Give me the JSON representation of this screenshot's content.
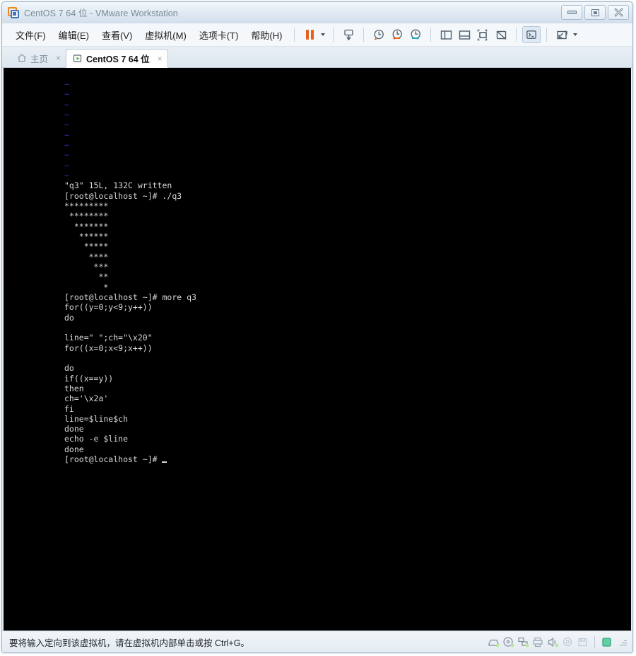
{
  "window": {
    "title": "CentOS 7 64 位 - VMware Workstation",
    "logo_icon": "vmware-logo-icon",
    "controls": {
      "minimize": "minimize-button",
      "maximize": "maximize-button",
      "close": "close-button"
    }
  },
  "menubar": {
    "items": [
      {
        "label": "文件(F)",
        "name": "menu-file"
      },
      {
        "label": "编辑(E)",
        "name": "menu-edit"
      },
      {
        "label": "查看(V)",
        "name": "menu-view"
      },
      {
        "label": "虚拟机(M)",
        "name": "menu-vm"
      },
      {
        "label": "选项卡(T)",
        "name": "menu-tabs"
      },
      {
        "label": "帮助(H)",
        "name": "menu-help"
      }
    ],
    "toolbar": [
      {
        "name": "pause-button",
        "icon": "pause-icon"
      },
      {
        "name": "pause-dropdown",
        "icon": "chevron-down-icon"
      },
      {
        "name": "send-ctrl-alt-del-button",
        "icon": "keyboard-send-icon"
      },
      {
        "name": "snapshot-take-button",
        "icon": "snapshot-clock-icon"
      },
      {
        "name": "snapshot-revert-button",
        "icon": "snapshot-revert-icon"
      },
      {
        "name": "snapshot-manager-button",
        "icon": "snapshot-manager-icon"
      },
      {
        "name": "show-library-button",
        "icon": "panel-left-icon"
      },
      {
        "name": "show-thumbnail-bar-button",
        "icon": "panel-bottom-icon"
      },
      {
        "name": "full-screen-button",
        "icon": "fullscreen-icon"
      },
      {
        "name": "unity-mode-button",
        "icon": "unity-mode-icon"
      },
      {
        "name": "console-view-button",
        "icon": "console-icon",
        "active": true
      },
      {
        "name": "stretch-guest-button",
        "icon": "stretch-icon"
      },
      {
        "name": "stretch-dropdown",
        "icon": "chevron-down-icon"
      }
    ]
  },
  "tabs": [
    {
      "label": "主页",
      "icon": "home-icon",
      "active": false,
      "close": "×",
      "name": "tab-home"
    },
    {
      "label": "CentOS 7 64 位",
      "icon": "vm-play-icon",
      "active": true,
      "close": "×",
      "name": "tab-centos7"
    }
  ],
  "terminal": {
    "lines": [
      {
        "text": "~",
        "style": "tilde"
      },
      {
        "text": "~",
        "style": "tilde"
      },
      {
        "text": "~",
        "style": "tilde"
      },
      {
        "text": "~",
        "style": "tilde"
      },
      {
        "text": "~",
        "style": "tilde"
      },
      {
        "text": "~",
        "style": "tilde"
      },
      {
        "text": "~",
        "style": "tilde"
      },
      {
        "text": "~",
        "style": "tilde"
      },
      {
        "text": "~",
        "style": "tilde"
      },
      {
        "text": "~",
        "style": "tilde"
      },
      {
        "text": "\"q3\" 15L, 132C written",
        "style": "normal"
      },
      {
        "text": "[root@localhost ~]# ./q3",
        "style": "normal"
      },
      {
        "text": "*********",
        "style": "normal"
      },
      {
        "text": " ********",
        "style": "normal"
      },
      {
        "text": "  *******",
        "style": "normal"
      },
      {
        "text": "   ******",
        "style": "normal"
      },
      {
        "text": "    *****",
        "style": "normal"
      },
      {
        "text": "     ****",
        "style": "normal"
      },
      {
        "text": "      ***",
        "style": "normal"
      },
      {
        "text": "       **",
        "style": "normal"
      },
      {
        "text": "        *",
        "style": "normal"
      },
      {
        "text": "[root@localhost ~]# more q3",
        "style": "normal"
      },
      {
        "text": "for((y=0;y<9;y++))",
        "style": "normal"
      },
      {
        "text": "do",
        "style": "normal"
      },
      {
        "text": "",
        "style": "normal"
      },
      {
        "text": "line=\" \";ch=\"\\x20\"",
        "style": "normal"
      },
      {
        "text": "for((x=0;x<9;x++))",
        "style": "normal"
      },
      {
        "text": "",
        "style": "normal"
      },
      {
        "text": "do",
        "style": "normal"
      },
      {
        "text": "if((x==y))",
        "style": "normal"
      },
      {
        "text": "then",
        "style": "normal"
      },
      {
        "text": "ch='\\x2a'",
        "style": "normal"
      },
      {
        "text": "fi",
        "style": "normal"
      },
      {
        "text": "line=$line$ch",
        "style": "normal"
      },
      {
        "text": "done",
        "style": "normal"
      },
      {
        "text": "echo -e $line",
        "style": "normal"
      },
      {
        "text": "done",
        "style": "normal"
      }
    ],
    "prompt_last": "[root@localhost ~]# ",
    "cursor": "block-cursor"
  },
  "statusbar": {
    "message": "要将输入定向到该虚拟机，请在虚拟机内部单击或按 Ctrl+G。",
    "icons": [
      {
        "name": "status-harddisk-icon"
      },
      {
        "name": "status-cddvd-icon"
      },
      {
        "name": "status-network-icon"
      },
      {
        "name": "status-printer-icon"
      },
      {
        "name": "status-sound-icon"
      },
      {
        "name": "status-usb-icon"
      },
      {
        "name": "status-floppy-icon"
      },
      {
        "name": "status-display-icon"
      }
    ],
    "resize_grip": "resize-grip"
  },
  "colors": {
    "terminal_bg": "#000000",
    "terminal_fg": "#d8d8d8",
    "vim_tilde": "#2f2fb8",
    "accent_orange": "#e8601c",
    "accent_blue": "#3f75c0",
    "status_green": "#4fbf8f"
  }
}
